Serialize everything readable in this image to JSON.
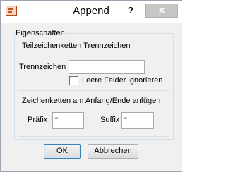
{
  "window": {
    "title": "Append",
    "help_label": "?",
    "close_label": "✕"
  },
  "properties": {
    "group_label": "Eigenschaften",
    "separator_group": {
      "label": "Teilzeichenketten Trennzeichen",
      "separator_label": "Trennzeichen",
      "separator_value": "",
      "ignore_empty_label": "Leere Felder ignorieren",
      "ignore_empty_checked": false
    },
    "affix_group": {
      "label": "Zeichenketten am Anfang/Ende anfügen",
      "prefix_label": "Präfix",
      "prefix_value": "\"",
      "suffix_label": "Suffix",
      "suffix_value": "\""
    }
  },
  "buttons": {
    "ok_label": "OK",
    "cancel_label": "Abbrechen"
  }
}
